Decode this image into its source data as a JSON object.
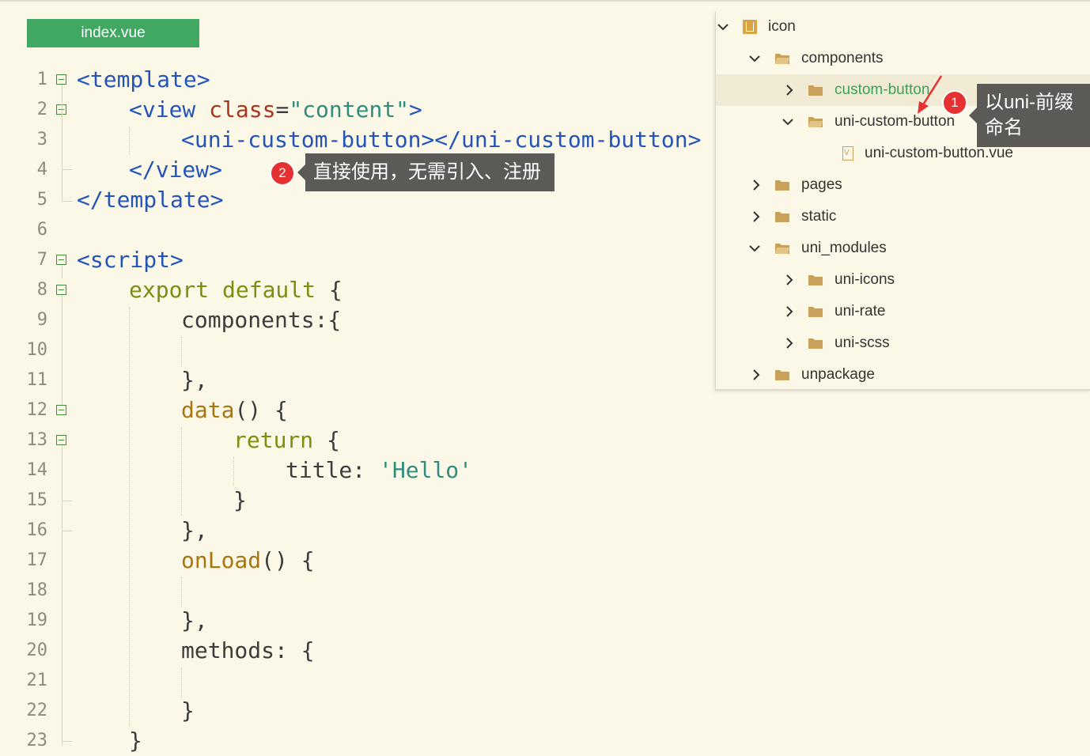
{
  "editor": {
    "tab_title": "index.vue",
    "line_numbers": [
      "1",
      "2",
      "3",
      "4",
      "5",
      "6",
      "7",
      "8",
      "9",
      "10",
      "11",
      "12",
      "13",
      "14",
      "15",
      "16",
      "17",
      "18",
      "19",
      "20",
      "21",
      "22",
      "23"
    ]
  },
  "code": {
    "l1_tag": "<template>",
    "l2_tag_open": "<view",
    "l2_attr": "class",
    "l2_eq": "=",
    "l2_str": "\"content\"",
    "l2_close": ">",
    "l3_tag": "<uni-custom-button></uni-custom-button>",
    "l4_tag": "</view>",
    "l5_tag": "</template>",
    "l7_tag": "<script>",
    "l8_kw": "export default",
    "l8_brace": " {",
    "l9_text": "components:{",
    "l11_text": "},",
    "l12_fn": "data",
    "l12_rest": "() {",
    "l13_kw": "return",
    "l13_rest": " {",
    "l14_key": "title: ",
    "l14_str": "'Hello'",
    "l15_text": "}",
    "l16_text": "},",
    "l17_fn": "onLoad",
    "l17_rest": "() {",
    "l19_text": "},",
    "l20_text": "methods: {",
    "l22_text": "}",
    "l23_text": "}"
  },
  "callouts": {
    "c1_badge": "1",
    "c1_text_line1": "以uni-前缀",
    "c1_text_line2": "命名",
    "c2_badge": "2",
    "c2_text": "直接使用，无需引入、注册"
  },
  "tree": {
    "root": "icon",
    "components": "components",
    "custom_button": "custom-button",
    "uni_custom_button": "uni-custom-button",
    "uni_custom_button_vue": "uni-custom-button.vue",
    "pages": "pages",
    "static": "static",
    "uni_modules": "uni_modules",
    "uni_icons": "uni-icons",
    "uni_rate": "uni-rate",
    "uni_scss": "uni-scss",
    "unpackage": "unpackage"
  },
  "colors": {
    "background": "#fcf8e8",
    "tab": "#41a863",
    "tag": "#2454b8",
    "attr": "#a8361d",
    "string": "#2f8c7f",
    "keyword": "#7f8c0e",
    "function": "#a8750e",
    "folder": "#c9a15a",
    "selected_text": "#3aa35a",
    "badge": "#e53131",
    "callout": "#5b5a56"
  }
}
